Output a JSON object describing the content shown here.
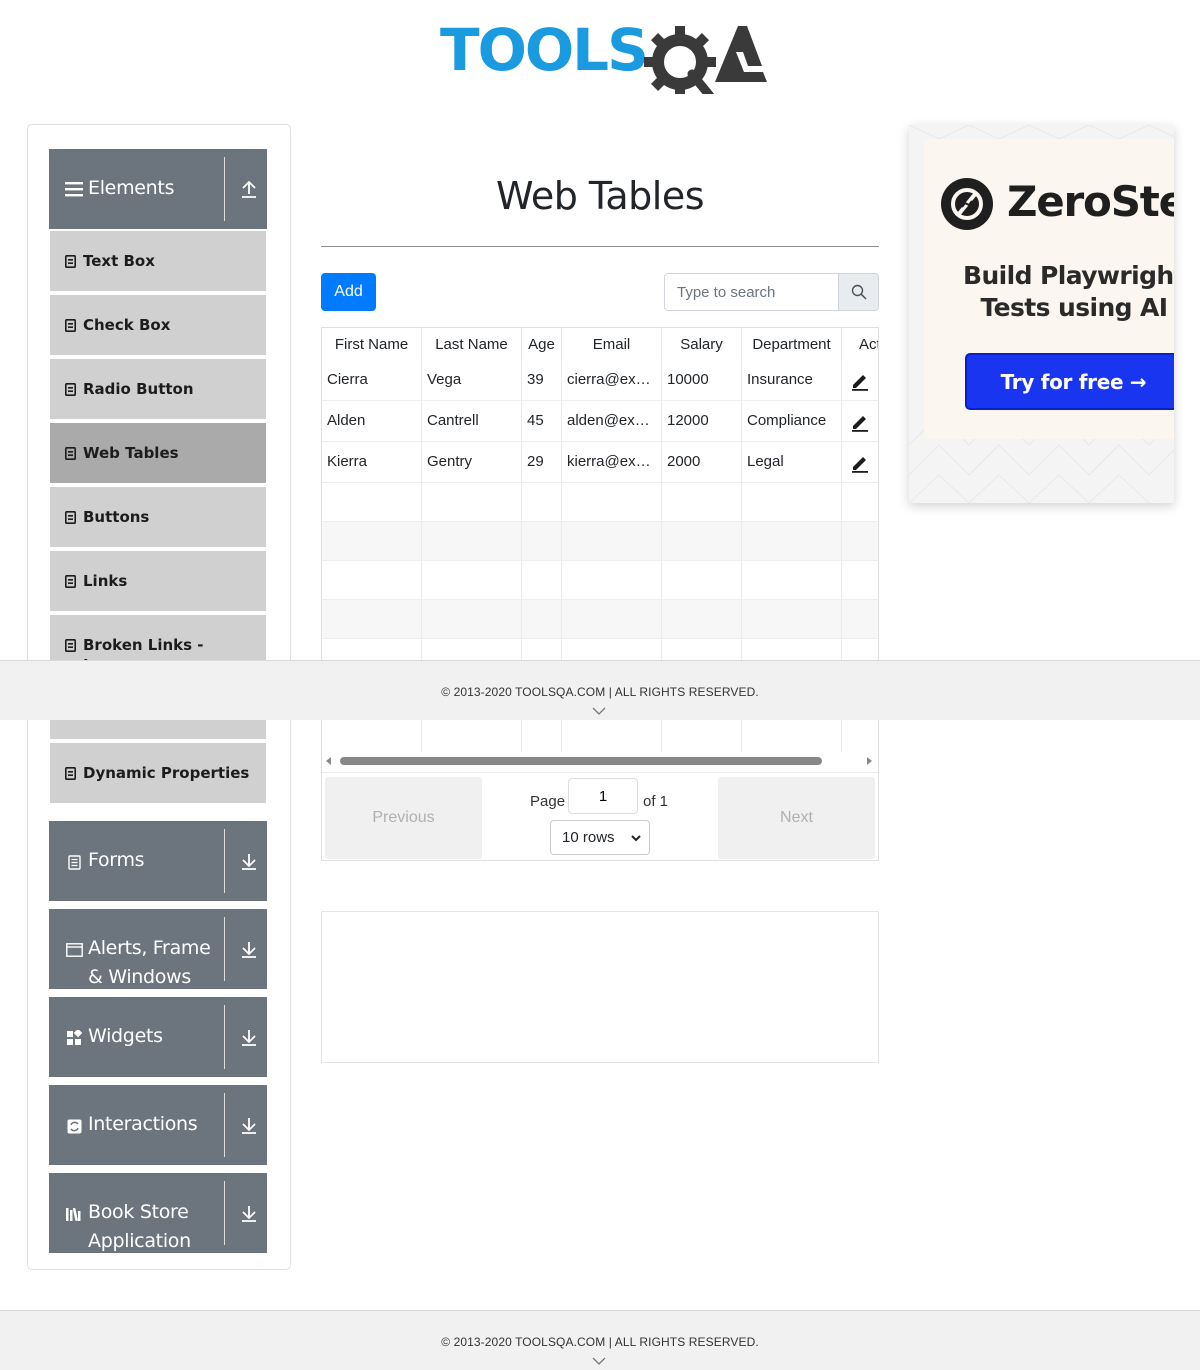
{
  "logo": {
    "text": "TOOLSQA",
    "brand_blue": "#1a9be0",
    "brand_dark": "#3a3a3a"
  },
  "sidebar": {
    "groups": [
      {
        "title": "Elements",
        "icon": "menu-icon",
        "arrow": "collapse-up-icon",
        "expanded": true,
        "items": [
          {
            "label": "Text Box",
            "active": false
          },
          {
            "label": "Check Box",
            "active": false
          },
          {
            "label": "Radio Button",
            "active": false
          },
          {
            "label": "Web Tables",
            "active": true
          },
          {
            "label": "Buttons",
            "active": false
          },
          {
            "label": "Links",
            "active": false
          },
          {
            "label": "Broken Links - Images",
            "active": false
          },
          {
            "label": "Dynamic Properties",
            "active": false
          }
        ]
      },
      {
        "title": "Forms",
        "icon": "form-icon",
        "arrow": "expand-down-icon"
      },
      {
        "title": "Alerts, Frame & Windows",
        "icon": "window-icon",
        "arrow": "expand-down-icon"
      },
      {
        "title": "Widgets",
        "icon": "widgets-icon",
        "arrow": "expand-down-icon"
      },
      {
        "title": "Interactions",
        "icon": "interactions-icon",
        "arrow": "expand-down-icon"
      },
      {
        "title": "Book Store Application",
        "icon": "books-icon",
        "arrow": "expand-down-icon"
      }
    ]
  },
  "main": {
    "title": "Web Tables",
    "add_label": "Add",
    "search_placeholder": "Type to search",
    "table": {
      "columns": [
        "First Name",
        "Last Name",
        "Age",
        "Email",
        "Salary",
        "Department",
        "Action"
      ],
      "rows": [
        {
          "first": "Cierra",
          "last": "Vega",
          "age": "39",
          "email": "cierra@ex…",
          "salary": "10000",
          "department": "Insurance"
        },
        {
          "first": "Alden",
          "last": "Cantrell",
          "age": "45",
          "email": "alden@ex…",
          "salary": "12000",
          "department": "Compliance"
        },
        {
          "first": "Kierra",
          "last": "Gentry",
          "age": "29",
          "email": "kierra@ex…",
          "salary": "2000",
          "department": "Legal"
        }
      ]
    },
    "pagination": {
      "previous": "Previous",
      "next": "Next",
      "page_label": "Page",
      "page_value": "1",
      "of_label": "of 1",
      "rows_option": "10 rows"
    }
  },
  "footer": {
    "text": "© 2013-2020 TOOLSQA.COM | ALL RIGHTS RESERVED."
  },
  "ad": {
    "brand": "ZeroStep",
    "tagline": "Build Playwright Tests using AI",
    "cta": "Try for free →",
    "cta_color": "#1a35f0"
  },
  "colors": {
    "accent": "#007bff",
    "sidebar_group": "#6c757d",
    "menu_item": "#d0d0d0",
    "menu_active": "#aaaaaa"
  }
}
